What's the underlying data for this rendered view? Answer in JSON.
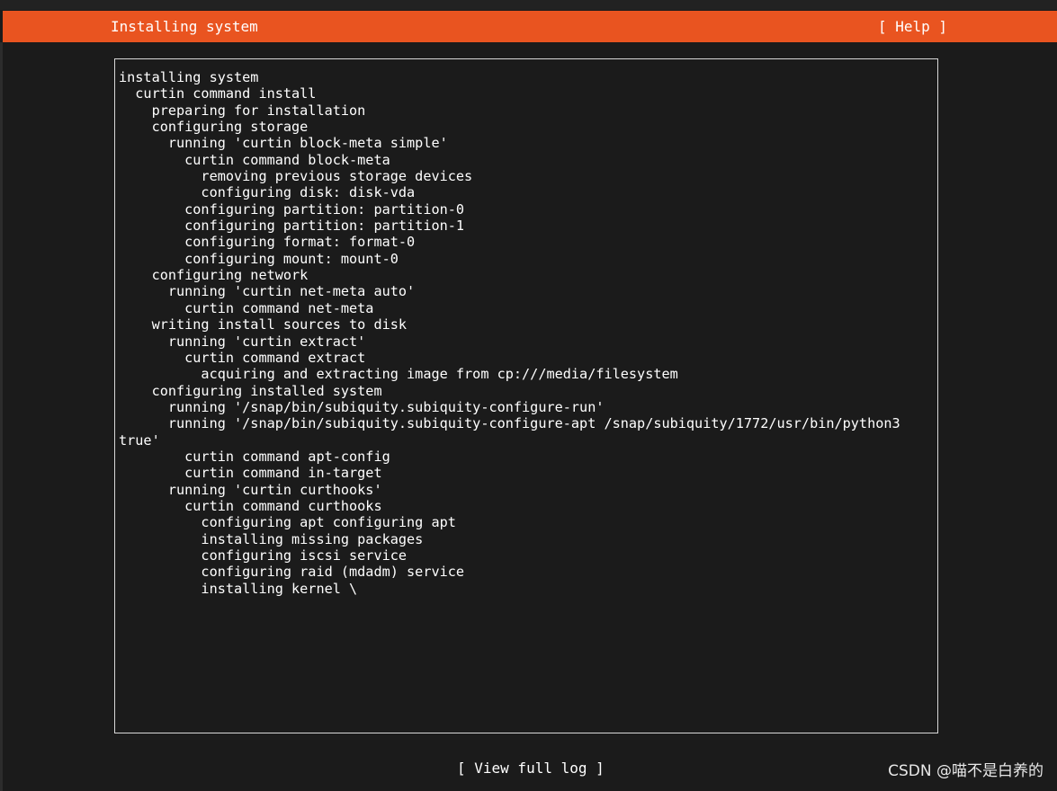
{
  "header": {
    "title": "Installing system",
    "help_label": "[ Help ]"
  },
  "log": {
    "lines": [
      "installing system",
      "  curtin command install",
      "    preparing for installation",
      "    configuring storage",
      "      running 'curtin block-meta simple'",
      "        curtin command block-meta",
      "          removing previous storage devices",
      "          configuring disk: disk-vda",
      "        configuring partition: partition-0",
      "        configuring partition: partition-1",
      "        configuring format: format-0",
      "        configuring mount: mount-0",
      "    configuring network",
      "      running 'curtin net-meta auto'",
      "        curtin command net-meta",
      "    writing install sources to disk",
      "      running 'curtin extract'",
      "        curtin command extract",
      "          acquiring and extracting image from cp:///media/filesystem",
      "    configuring installed system",
      "      running '/snap/bin/subiquity.subiquity-configure-run'",
      "      running '/snap/bin/subiquity.subiquity-configure-apt /snap/subiquity/1772/usr/bin/python3",
      "true'",
      "        curtin command apt-config",
      "        curtin command in-target",
      "      running 'curtin curthooks'",
      "        curtin command curthooks",
      "          configuring apt configuring apt",
      "          installing missing packages",
      "          configuring iscsi service",
      "          configuring raid (mdadm) service",
      "          installing kernel \\"
    ]
  },
  "footer": {
    "view_log_label": "[ View full log ]"
  },
  "watermark": {
    "text": "CSDN @喵不是白养的"
  },
  "colors": {
    "accent": "#e95420",
    "background": "#1b1b1b",
    "text": "#ffffff",
    "border": "#d8d8d8"
  }
}
